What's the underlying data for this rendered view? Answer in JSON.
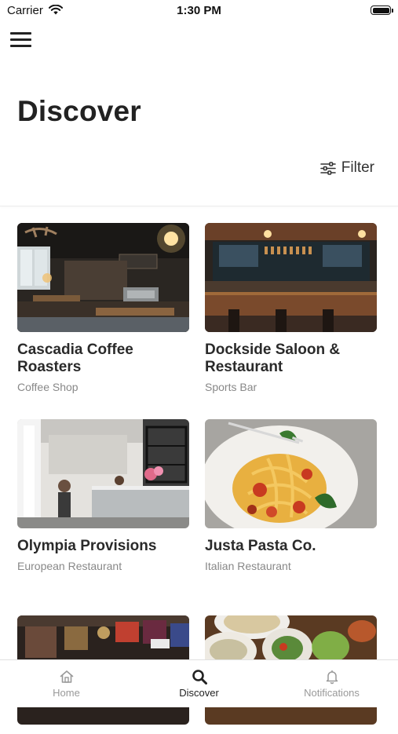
{
  "status_bar": {
    "carrier": "Carrier",
    "time": "1:30 PM"
  },
  "header": {
    "menu_icon": "hamburger-menu-icon",
    "title": "Discover",
    "filter_label": "Filter",
    "filter_icon": "sliders-icon"
  },
  "places": [
    {
      "name": "Cascadia Coffee Roasters",
      "category": "Coffee Shop"
    },
    {
      "name": "Dockside Saloon & Restaurant",
      "category": "Sports Bar"
    },
    {
      "name": "Olympia Provisions",
      "category": "European Restaurant"
    },
    {
      "name": "Justa Pasta Co.",
      "category": "Italian Restaurant"
    },
    {
      "name": "",
      "category": ""
    },
    {
      "name": "",
      "category": ""
    }
  ],
  "tab_bar": {
    "active": "Discover",
    "tabs": [
      {
        "label": "Home",
        "icon": "home-icon"
      },
      {
        "label": "Discover",
        "icon": "search-icon"
      },
      {
        "label": "Notifications",
        "icon": "bell-icon"
      }
    ]
  },
  "colors": {
    "text_primary": "#222222",
    "text_secondary": "#888888",
    "tab_inactive": "#999999",
    "divider": "#ececec"
  }
}
